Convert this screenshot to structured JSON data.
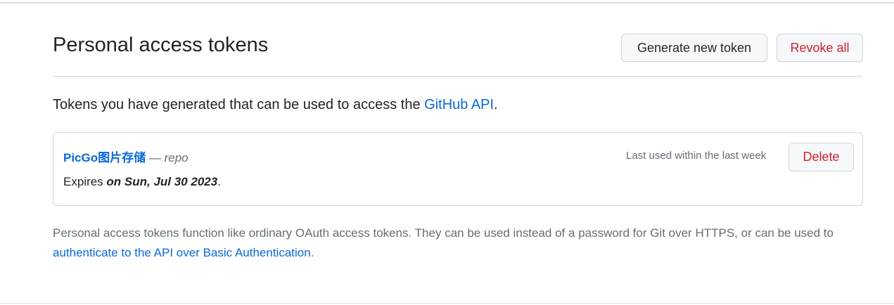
{
  "header": {
    "title": "Personal access tokens",
    "generate_label": "Generate new token",
    "revoke_label": "Revoke all"
  },
  "intro": {
    "text": "Tokens you have generated that can be used to access the ",
    "link_text": "GitHub API",
    "suffix": "."
  },
  "token": {
    "name": "PicGo图片存储",
    "separator": " — ",
    "scope": "repo",
    "expires_prefix": "Expires ",
    "expires_date": "on Sun, Jul 30 2023",
    "expires_suffix": ".",
    "last_used": "Last used within the last week",
    "delete_label": "Delete"
  },
  "note": {
    "text": "Personal access tokens function like ordinary OAuth access tokens. They can be used instead of a password for Git over HTTPS, or can be used to ",
    "link_text": "authenticate to the API over Basic Authentication",
    "suffix": "."
  },
  "colors": {
    "link": "#0969da",
    "danger": "#cf222e",
    "muted": "#656d76",
    "border": "#d0d7de"
  }
}
